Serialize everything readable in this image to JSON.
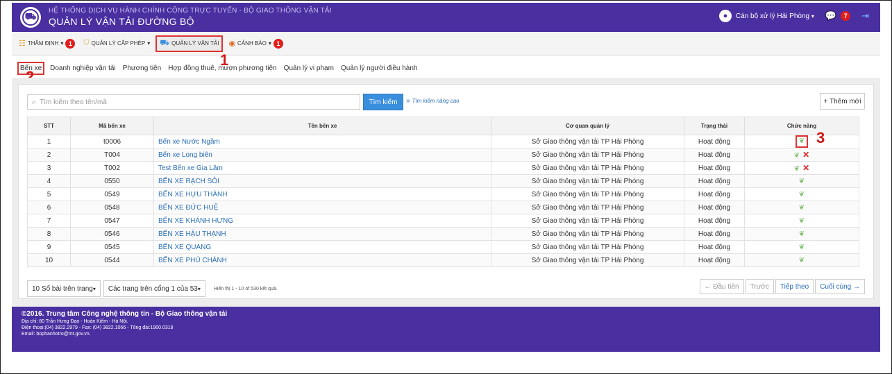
{
  "header": {
    "system_title": "HỆ THỐNG DỊCH VỤ HÀNH CHÍNH CÔNG TRỰC TUYẾN - BỘ GIAO THÔNG VẬN TẢI",
    "app_title": "QUẢN LÝ VẬN TẢI ĐƯỜNG BỘ",
    "user_name": "Cán bộ xử lý Hải Phòng",
    "notification_count": "7"
  },
  "main_nav": [
    {
      "label": "THẨM ĐỊNH",
      "badge": "1"
    },
    {
      "label": "QUẢN LÝ CẤP PHÉP",
      "badge": ""
    },
    {
      "label": "QUẢN LÝ VẬN TẢI",
      "badge": ""
    },
    {
      "label": "CẢNH BÁO",
      "badge": "1"
    }
  ],
  "sub_nav": [
    "Bến xe",
    "Doanh nghiệp vận tải",
    "Phương tiện",
    "Hợp đồng thuê, mượn phương tiện",
    "Quản lý vi phạm",
    "Quản lý người điều hành"
  ],
  "step_labels": {
    "one": "1",
    "two": "2",
    "three": "3"
  },
  "search": {
    "placeholder": "Tìm kiếm theo tên/mã",
    "button": "Tìm kiếm",
    "advanced_arrows": "»",
    "advanced": "Tìm kiếm nâng cao",
    "add_new": "+ Thêm mới"
  },
  "table": {
    "headers": [
      "STT",
      "Mã bến xe",
      "Tên bến xe",
      "Cơ quan quản lý",
      "Trạng thái",
      "Chức năng"
    ],
    "rows": [
      {
        "stt": "1",
        "code": "t0006",
        "name": "Bến xe Nước Ngầm",
        "agency": "Sở Giao thông vận tải TP Hải Phòng",
        "status": "Hoạt động"
      },
      {
        "stt": "2",
        "code": "T004",
        "name": "Bến xe Long biên",
        "agency": "Sở Giao thông vận tải TP Hải Phòng",
        "status": "Hoạt động"
      },
      {
        "stt": "3",
        "code": "T002",
        "name": "Test Bến xe Gia Lâm",
        "agency": "Sở Giao thông vận tải TP Hải Phòng",
        "status": "Hoạt động"
      },
      {
        "stt": "4",
        "code": "0550",
        "name": "BẾN XE RẠCH SỎI",
        "agency": "Sở Giao thông vận tải TP Hải Phòng",
        "status": "Hoạt động"
      },
      {
        "stt": "5",
        "code": "0549",
        "name": "BẾN XE HỰU THÀNH",
        "agency": "Sở Giao thông vận tải TP Hải Phòng",
        "status": "Hoạt động"
      },
      {
        "stt": "6",
        "code": "0548",
        "name": "BẾN XE ĐỨC HUỆ",
        "agency": "Sở Giao thông vận tải TP Hải Phòng",
        "status": "Hoạt động"
      },
      {
        "stt": "7",
        "code": "0547",
        "name": "BẾN XE KHÁNH HƯNG",
        "agency": "Sở Giao thông vận tải TP Hải Phòng",
        "status": "Hoạt động"
      },
      {
        "stt": "8",
        "code": "0546",
        "name": "BẾN XE HẬU THẠNH",
        "agency": "Sở Giao thông vận tải TP Hải Phòng",
        "status": "Hoạt động"
      },
      {
        "stt": "9",
        "code": "0545",
        "name": "BẾN XE QUANG",
        "agency": "Sở Giao thông vận tải TP Hải Phòng",
        "status": "Hoạt động"
      },
      {
        "stt": "10",
        "code": "0544",
        "name": "BẾN XE PHÚ CHÁNH",
        "agency": "Sở Giao thông vận tải TP Hải Phòng",
        "status": "Hoạt động"
      }
    ]
  },
  "pagination": {
    "page_size": "10 Số bài trên trang",
    "page_select": "Các trang trên cổng 1 của 53",
    "info": "Hiển thị 1 - 10 of 530 kết quả.",
    "first": "← Đầu tiên",
    "prev": "Trước",
    "next": "Tiếp theo",
    "last": "Cuối cùng →"
  },
  "footer": {
    "title": "©2016. Trung tâm Công nghệ thông tin - Bộ Giao thông vận tải",
    "address": "Địa chỉ: 80 Trần Hưng Đạo - Hoàn Kiếm - Hà Nội.",
    "phone": "Điện thoại:(04) 3822.2979 - Fax: (04) 3822.1066 - Tổng đài:1900.0318",
    "email": "Email: bophanhotro@mt.gov.vn."
  },
  "colors": {
    "brand": "#4a2fa0",
    "accent": "#3a8ede",
    "highlight": "#d33"
  }
}
